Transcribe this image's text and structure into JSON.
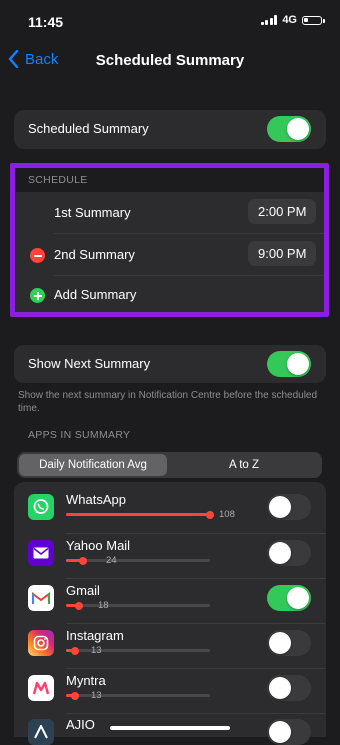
{
  "status": {
    "time": "11:45",
    "network": "4G"
  },
  "nav": {
    "back_label": "Back",
    "title": "Scheduled Summary"
  },
  "scheduled": {
    "label": "Scheduled Summary",
    "enabled": true
  },
  "schedule": {
    "header": "SCHEDULE",
    "first": {
      "label": "1st Summary",
      "time": "2:00 PM"
    },
    "second": {
      "label": "2nd Summary",
      "time": "9:00 PM"
    },
    "add_label": "Add Summary"
  },
  "next_summary": {
    "label": "Show Next Summary",
    "enabled": true,
    "footnote": "Show the next summary in Notification Centre before the scheduled time."
  },
  "apps_section": {
    "header": "APPS IN SUMMARY",
    "tabs": [
      "Daily Notification Avg",
      "A to Z"
    ],
    "active_tab": 0
  },
  "apps": [
    {
      "name": "WhatsApp",
      "avg": "108",
      "level": 1.0,
      "enabled": false,
      "icon": "whatsapp-icon",
      "color": "#25d366"
    },
    {
      "name": "Yahoo Mail",
      "avg": "24",
      "level": 0.12,
      "enabled": false,
      "icon": "yahoo-mail-icon",
      "color": "#6001d2"
    },
    {
      "name": "Gmail",
      "avg": "18",
      "level": 0.09,
      "enabled": true,
      "icon": "gmail-icon",
      "color": "#ffffff"
    },
    {
      "name": "Instagram",
      "avg": "13",
      "level": 0.065,
      "enabled": false,
      "icon": "instagram-icon",
      "color": "#d62976"
    },
    {
      "name": "Myntra",
      "avg": "13",
      "level": 0.065,
      "enabled": false,
      "icon": "myntra-icon",
      "color": "#ffffff"
    },
    {
      "name": "AJIO",
      "avg": "",
      "level": 0.05,
      "enabled": false,
      "icon": "ajio-icon",
      "color": "#2c4152"
    }
  ],
  "colors": {
    "accent": "#0a84ff",
    "toggle_on": "#34c759",
    "highlight": "#8a1fe0",
    "slider": "#ff453a"
  }
}
